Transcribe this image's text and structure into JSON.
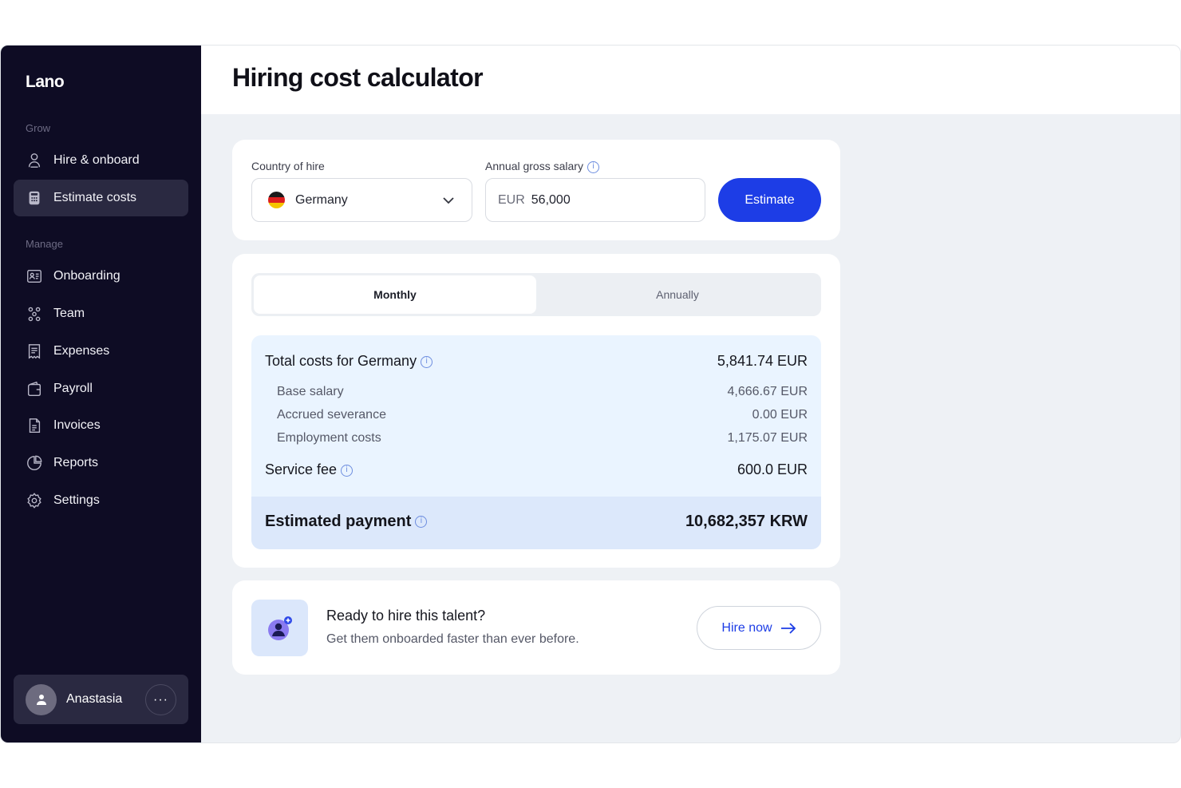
{
  "brand": {
    "logo": "Lano"
  },
  "sidebar": {
    "sections": [
      {
        "label": "Grow",
        "items": [
          {
            "label": "Hire & onboard",
            "icon": "person-icon",
            "active": false
          },
          {
            "label": "Estimate costs",
            "icon": "calculator-icon",
            "active": true
          }
        ]
      },
      {
        "label": "Manage",
        "items": [
          {
            "label": "Onboarding",
            "icon": "id-card-icon",
            "active": false
          },
          {
            "label": "Team",
            "icon": "team-icon",
            "active": false
          },
          {
            "label": "Expenses",
            "icon": "receipt-icon",
            "active": false
          },
          {
            "label": "Payroll",
            "icon": "wallet-icon",
            "active": false
          },
          {
            "label": "Invoices",
            "icon": "invoice-icon",
            "active": false
          },
          {
            "label": "Reports",
            "icon": "pie-chart-icon",
            "active": false
          },
          {
            "label": "Settings",
            "icon": "gear-icon",
            "active": false
          }
        ]
      }
    ],
    "user": {
      "name": "Anastasia",
      "more_label": "···"
    }
  },
  "page": {
    "title": "Hiring cost calculator"
  },
  "form": {
    "country_label": "Country of hire",
    "country_value": "Germany",
    "salary_label": "Annual gross salary",
    "salary_currency": "EUR",
    "salary_value": "56,000",
    "estimate_label": "Estimate"
  },
  "tabs": [
    {
      "label": "Monthly",
      "active": true
    },
    {
      "label": "Annually",
      "active": false
    }
  ],
  "costs": {
    "total_label": "Total costs for Germany",
    "total_value": "5,841.74 EUR",
    "lines": [
      {
        "label": "Base salary",
        "value": "4,666.67 EUR"
      },
      {
        "label": "Accrued severance",
        "value": "0.00 EUR"
      },
      {
        "label": "Employment costs",
        "value": "1,175.07 EUR"
      }
    ],
    "service_fee_label": "Service fee",
    "service_fee_value": "600.0 EUR",
    "estimated_label": "Estimated payment",
    "estimated_value": "10,682,357 KRW"
  },
  "hire_cta": {
    "title": "Ready to hire this talent?",
    "subtitle": "Get them onboarded faster than ever before.",
    "button_label": "Hire now"
  },
  "colors": {
    "sidebar_bg": "#0e0c24",
    "accent": "#1d3de6",
    "cost_box_bg": "#eaf4ff",
    "estimate_band_bg": "#dce8fb"
  }
}
